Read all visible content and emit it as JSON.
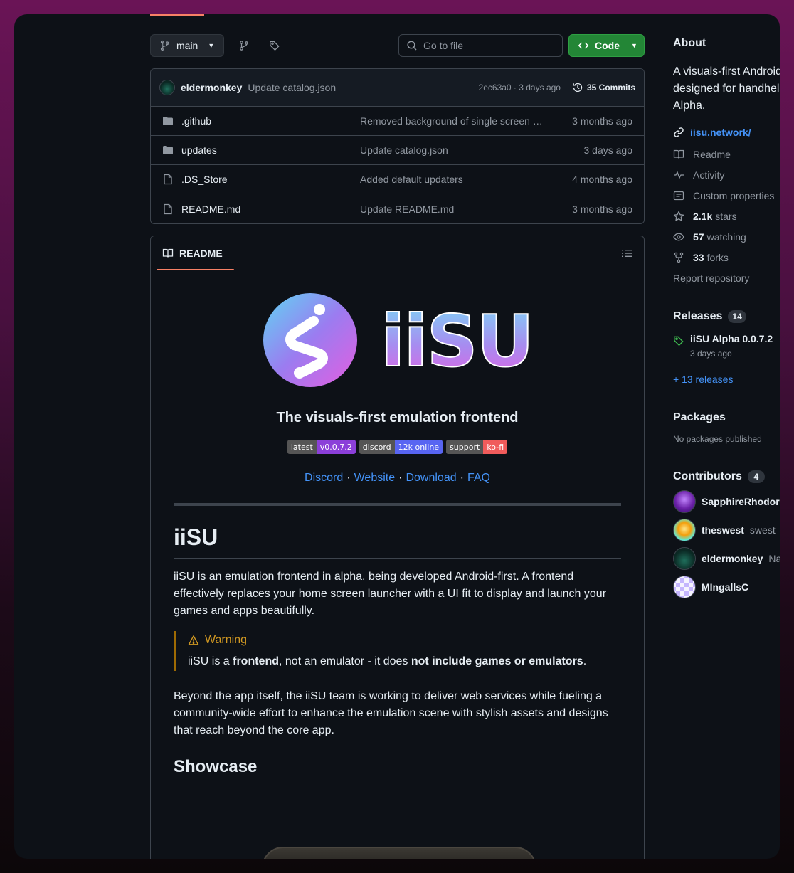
{
  "toolbar": {
    "branch": "main",
    "go_to_file_placeholder": "Go to file",
    "code_label": "Code"
  },
  "commit": {
    "author": "eldermonkey",
    "message": "Update catalog.json",
    "meta": "2ec63a0 · 3 days ago",
    "commits": "35 Commits"
  },
  "files": [
    {
      "name": ".github",
      "type": "folder",
      "commit": "Removed background of single screen …",
      "date": "3 months ago"
    },
    {
      "name": "updates",
      "type": "folder",
      "commit": "Update catalog.json",
      "date": "3 days ago"
    },
    {
      "name": ".DS_Store",
      "type": "file",
      "commit": "Added default updaters",
      "date": "4 months ago"
    },
    {
      "name": "README.md",
      "type": "file",
      "commit": "Update README.md",
      "date": "3 months ago"
    }
  ],
  "readme": {
    "tab": "README",
    "logo_text": "iiSU",
    "tagline": "The visuals-first emulation frontend",
    "badges": [
      {
        "left": "latest",
        "right": "v0.0.7.2",
        "color": "#8b3fd9"
      },
      {
        "left": "discord",
        "right": "12k online",
        "color": "#5865f2"
      },
      {
        "left": "support",
        "right": "ko-fi",
        "color": "#f05b5b"
      }
    ],
    "links": [
      "Discord",
      "Website",
      "Download",
      "FAQ"
    ],
    "separator": "·",
    "h1": "iiSU",
    "intro": "iiSU is an emulation frontend in alpha, being developed Android-first. A frontend effectively replaces your home screen launcher with a UI fit to display and launch your games and apps beautifully.",
    "warning": {
      "title": "Warning",
      "p1": "iiSU is a ",
      "b1": "frontend",
      "p2": ", not an emulator - it does ",
      "b2": "not include games or emulators",
      "p3": "."
    },
    "beyond": "Beyond the app itself, the iiSU team is working to deliver web services while fueling a community-wide effort to enhance the emulation scene with stylish assets and designs that reach beyond the core app.",
    "h2": "Showcase"
  },
  "about": {
    "title": "About",
    "line1": "A visuals-first Android",
    "line2": "designed for handhel",
    "line3": "Alpha.",
    "website": "iisu.network/",
    "items": [
      {
        "icon": "book-icon",
        "bold": "",
        "label": "Readme"
      },
      {
        "icon": "pulse-icon",
        "bold": "",
        "label": "Activity"
      },
      {
        "icon": "note-icon",
        "bold": "",
        "label": "Custom properties"
      },
      {
        "icon": "star-icon",
        "bold": "2.1k",
        "label": "stars"
      },
      {
        "icon": "eye-icon",
        "bold": "57",
        "label": "watching"
      },
      {
        "icon": "fork-icon",
        "bold": "33",
        "label": "forks"
      }
    ],
    "report": "Report repository"
  },
  "releases": {
    "title": "Releases",
    "count": "14",
    "latest": "iiSU Alpha 0.0.7.2",
    "date": "3 days ago",
    "more": "+ 13 releases"
  },
  "packages": {
    "title": "Packages",
    "note": "No packages published"
  },
  "contributors": {
    "title": "Contributors",
    "count": "4",
    "list": [
      {
        "name": "SapphireRhodor",
        "sub": ""
      },
      {
        "name": "theswest",
        "sub": "swest"
      },
      {
        "name": "eldermonkey",
        "sub": "Nat"
      },
      {
        "name": "MIngallsC",
        "sub": ""
      }
    ]
  }
}
